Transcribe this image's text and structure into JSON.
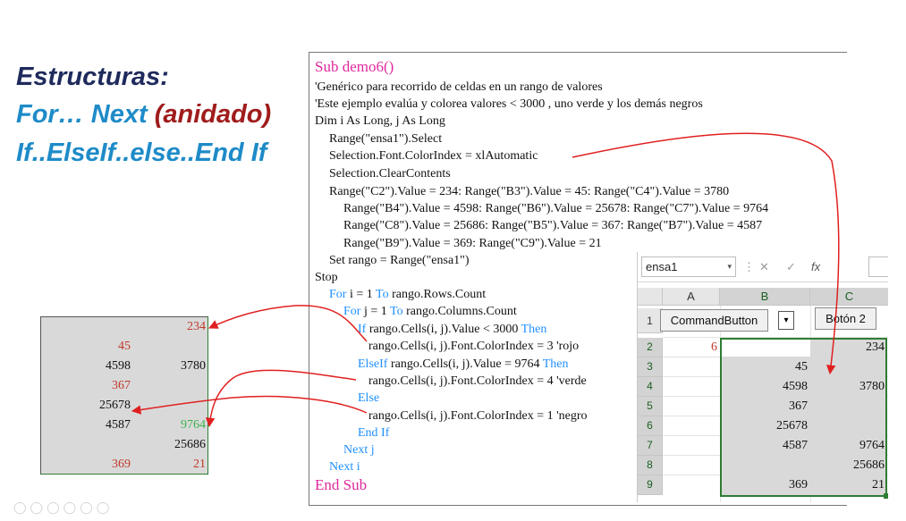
{
  "titles": {
    "line1": "Estructuras:",
    "line2_part1": "For… Next ",
    "line2_part2": "(anidado)",
    "line3": "If..ElseIf..else..End If"
  },
  "colors": {
    "magenta": "#e0289c",
    "blue": "#1e90ff",
    "red": "#c0392b",
    "green": "#3bb34a",
    "selection": "#2e7d32",
    "arrow": "#e02020"
  },
  "code": {
    "l1": "Sub demo6()",
    "l2": "'Genérico para recorrido de celdas en un rango de valores",
    "l3": "'Este ejemplo evalúa y colorea valores < 3000 , uno verde y los demás negros",
    "l4": " Dim i As Long, j As Long",
    "l5": "Range(\"ensa1\").Select",
    "l6": "Selection.Font.ColorIndex = xlAutomatic",
    "l7": "Selection.ClearContents",
    "l8": "Range(\"C2\").Value = 234: Range(\"B3\").Value = 45: Range(\"C4\").Value = 3780",
    "l9": "Range(\"B4\").Value = 4598: Range(\"B6\").Value = 25678: Range(\"C7\").Value = 9764",
    "l10": "Range(\"C8\").Value = 25686: Range(\"B5\").Value = 367: Range(\"B7\").Value = 4587",
    "l11": "Range(\"B9\").Value = 369: Range(\"C9\").Value = 21",
    "l12": "Set rango = Range(\"ensa1\")",
    "l13": "Stop",
    "l14a": "For",
    "l14b": " i = 1 ",
    "l14c": "To",
    "l14d": " rango.Rows.Count",
    "l15a": "For",
    "l15b": " j = 1 ",
    "l15c": "To",
    "l15d": " rango.Columns.Count",
    "l16a": "If",
    "l16b": " rango.Cells(i, j).Value < 3000 ",
    "l16c": "Then",
    "l17": "rango.Cells(i, j).Font.ColorIndex = 3   'rojo",
    "l18a": "ElseIf",
    "l18b": " rango.Cells(i, j).Value = 9764 ",
    "l18c": "Then",
    "l19": " rango.Cells(i, j).Font.ColorIndex = 4   'verde",
    "l20": "Else",
    "l21": "rango.Cells(i, j).Font.ColorIndex = 1   'negro",
    "l22": "End If",
    "l23": "Next j",
    "l24": "Next i",
    "l25": "End Sub"
  },
  "mini_sheet": {
    "r1c2": "234",
    "r2c1": "45",
    "r3c1": "4598",
    "r3c2": "3780",
    "r4c1": "367",
    "r5c1": "25678",
    "r6c1": "4587",
    "r6c2": "9764",
    "r7c2": "25686",
    "r8c1": "369",
    "r8c2": "21"
  },
  "excel": {
    "name_box": "ensa1",
    "name_box_arrow": "▾",
    "fb_sep": "⋮",
    "fb_cancel": "✕",
    "fb_enter": "✓",
    "fb_fx": "fx",
    "col_a": "A",
    "col_b": "B",
    "col_c": "C",
    "rows": [
      "1",
      "2",
      "3",
      "4",
      "5",
      "6",
      "7",
      "8",
      "9"
    ],
    "command_button": "CommandButton",
    "combo_arrow": "▾",
    "button2": "Botón 2",
    "a2_partial": "6",
    "cells": {
      "c2": "234",
      "b3": "45",
      "b4": "4598",
      "c4": "3780",
      "b5": "367",
      "b6": "25678",
      "b7": "4587",
      "c7": "9764",
      "c8": "25686",
      "b9": "369",
      "c9": "21"
    }
  },
  "bottom_icons": "◯◯◯◯◯◯"
}
